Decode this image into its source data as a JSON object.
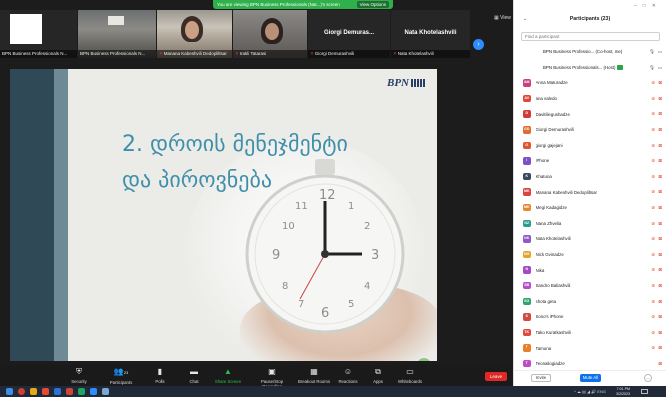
{
  "banner": {
    "text": "You are viewing BPN Business Professionals (Nat...)'s screen",
    "options": "View Options"
  },
  "thumbs": [
    {
      "caption": "BPN Business Professionals N..."
    },
    {
      "caption": "BPN Business Professionals N..."
    },
    {
      "caption": "Manana Kabeshvili Dedopliltsar"
    },
    {
      "caption": "Irakli Tatarasi"
    },
    {
      "name": "Giorgi Demuras...",
      "caption": "Giorgi Demurashvili"
    },
    {
      "name": "Nata Khotelashvili",
      "caption": "Nata Khotelashvili"
    }
  ],
  "view_label": "View",
  "slide": {
    "title_line1": "2. დროის მენეჯმენტი",
    "title_line2": "და პიროვნება",
    "logo": "BPN"
  },
  "toolbar": [
    {
      "icon": "shield-icon",
      "glyph": "⛨",
      "label": "Security"
    },
    {
      "icon": "people-icon",
      "glyph": "👥",
      "label": "Participants",
      "badge": "23"
    },
    {
      "icon": "chart-icon",
      "glyph": "▮",
      "label": "Polls"
    },
    {
      "icon": "chat-icon",
      "glyph": "▬",
      "label": "Chat"
    },
    {
      "icon": "share-screen-icon",
      "glyph": "▲",
      "label": "Share Screen"
    },
    {
      "icon": "record-icon",
      "glyph": "▣",
      "label": "Pause/Stop Recording"
    },
    {
      "icon": "breakout-icon",
      "glyph": "▦",
      "label": "Breakout Rooms"
    },
    {
      "icon": "reaction-icon",
      "glyph": "☺",
      "label": "Reactions"
    },
    {
      "icon": "apps-icon",
      "glyph": "⧉",
      "label": "Apps"
    },
    {
      "icon": "whiteboard-icon",
      "glyph": "▭",
      "label": "Whiteboards"
    }
  ],
  "leave_label": "Leave",
  "panel": {
    "title": "Participants (23)",
    "search_placeholder": "Find a participant",
    "participants": [
      {
        "initials": "",
        "name": "BPN Business Professio... (Co-host, me)",
        "color": "",
        "host": true,
        "mic_ok": true
      },
      {
        "initials": "",
        "name": "BPN Business Professionals... (Host)",
        "color": "",
        "host": true,
        "mic_ok": true
      },
      {
        "initials": "AM",
        "name": "Anna Maturadze",
        "color": "#c9417c"
      },
      {
        "initials": "AV",
        "name": "ana valedo",
        "color": "#e0473b"
      },
      {
        "initials": "D",
        "name": "Davitiliegushadze",
        "color": "#d23a3a"
      },
      {
        "initials": "GD",
        "name": "Giorgi Demurashvili",
        "color": "#e06c2f"
      },
      {
        "initials": "G",
        "name": "giorgi gajejani",
        "color": "#e2572c"
      },
      {
        "initials": "I",
        "name": "iPhone",
        "color": "#7e4fc6"
      },
      {
        "initials": "K",
        "name": "Khatuna",
        "color": "#3a4a5c"
      },
      {
        "initials": "MK",
        "name": "Manana Kabeshvili Dedopliltsar",
        "color": "#d9443e"
      },
      {
        "initials": "MK",
        "name": "Megi Kadagidze",
        "color": "#e38a2d"
      },
      {
        "initials": "NZ",
        "name": "Nana Zhvelia",
        "color": "#2d9c8a"
      },
      {
        "initials": "NK",
        "name": "Nata Khotelashvili",
        "color": "#8e58c9"
      },
      {
        "initials": "NG",
        "name": "Nick Gvinadze",
        "color": "#e4a42a"
      },
      {
        "initials": "N",
        "name": "Nika",
        "color": "#a34bc6"
      },
      {
        "initials": "SB",
        "name": "Sandro Baliashvili",
        "color": "#b44fc8"
      },
      {
        "initials": "SG",
        "name": "shota geta",
        "color": "#31a36b"
      },
      {
        "initials": "S",
        "name": "Soso's iPhone",
        "color": "#d24a3f"
      },
      {
        "initials": "TK",
        "name": "Tako Kuratkashvili",
        "color": "#e04b3f"
      },
      {
        "initials": "T",
        "name": "Tamuna",
        "color": "#e8802a"
      },
      {
        "initials": "T",
        "name": "Teonaliogiadze",
        "color": "#c04bc4"
      }
    ],
    "invite": "Invite",
    "mute_all": "Mute All",
    "more": "..."
  },
  "taskbar": {
    "time": "7:01 PM",
    "date": "3/2/2023",
    "lang": "ENG"
  }
}
